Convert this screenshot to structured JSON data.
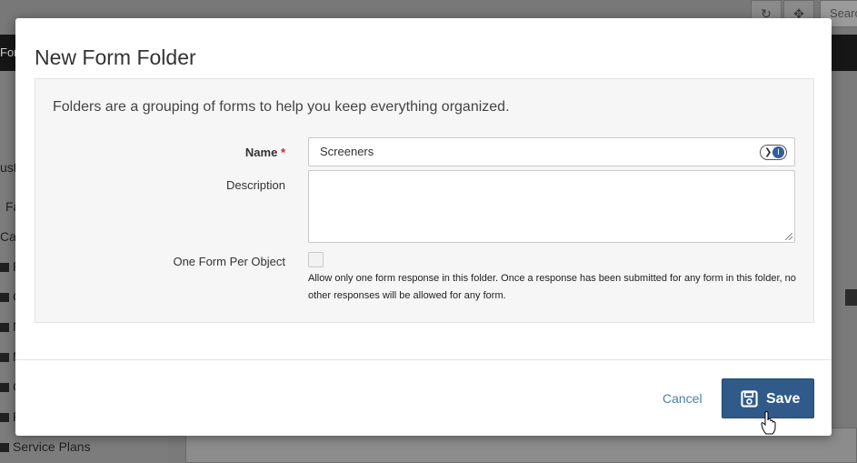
{
  "background": {
    "search_placeholder": "Search",
    "nav_text": "For",
    "sidebar_items": [
      "ustc",
      "Fa",
      "Ca",
      "R",
      "C",
      "N",
      "M",
      "C",
      "R"
    ],
    "sidebar_last": "Service Plans"
  },
  "modal": {
    "title": "New Form Folder",
    "intro": "Folders are a grouping of forms to help you keep everything organized.",
    "name_label": "Name",
    "required_mark": "*",
    "name_value": "Screeners",
    "description_label": "Description",
    "description_value": "",
    "one_form_label": "One Form Per Object",
    "one_form_checked": false,
    "one_form_help": "Allow only one form response in this folder. Once a response has been submitted for any form in this folder, no other responses will be allowed for any form.",
    "cancel_label": "Cancel",
    "save_label": "Save"
  },
  "colors": {
    "primary": "#2f5a8a",
    "link": "#4a7fb0",
    "required": "#c62828"
  }
}
